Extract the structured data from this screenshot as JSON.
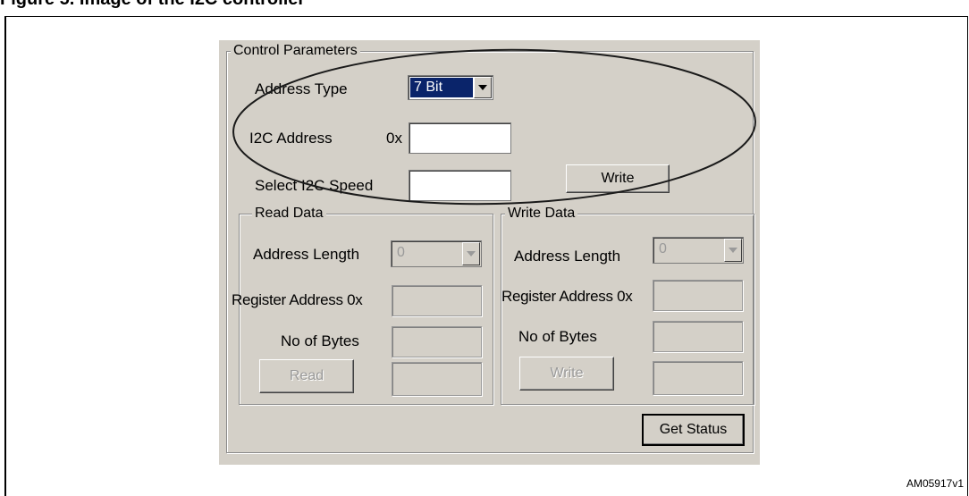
{
  "caption": "Figure 5. Image of the I2C controller",
  "figure_id": "AM05917v1",
  "control_parameters": {
    "title": "Control Parameters",
    "address_type_label": "Address Type",
    "address_type_value": "7 Bit",
    "i2c_address_label": "I2C Address",
    "hex_prefix": "0x",
    "i2c_address_value": "",
    "speed_label": "Select I2C Speed",
    "speed_value": "",
    "write_button": "Write"
  },
  "read_data": {
    "title": "Read Data",
    "address_length_label": "Address Length",
    "address_length_value": "0",
    "register_address_label": "Register Address 0x",
    "no_of_bytes_label": "No of Bytes",
    "read_button": "Read"
  },
  "write_data": {
    "title": "Write Data",
    "address_length_label": "Address Length",
    "address_length_value": "0",
    "register_address_label": "Register Address 0x",
    "no_of_bytes_label": "No of Bytes",
    "write_button": "Write"
  },
  "get_status_button": "Get Status",
  "colors": {
    "panel": "#d4d0c8",
    "selection": "#0a246a"
  }
}
